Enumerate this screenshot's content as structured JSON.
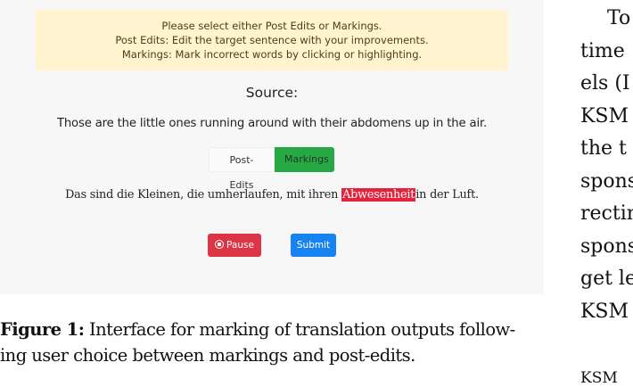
{
  "notice": {
    "line1": "Please select either Post Edits or Markings.",
    "line2": "Post Edits: Edit the target sentence with your improvements.",
    "line3": "Markings: Mark incorrect words by clicking or highlighting."
  },
  "source": {
    "label": "Source:",
    "text": "Those are the little ones running around with their abdomens up in the air."
  },
  "toggle": {
    "post_edits_label": "Post-Edits",
    "markings_label": "Markings",
    "active": "Markings"
  },
  "target": {
    "before": "Das sind die Kleinen, die umherlaufen, mit ihren ",
    "marked": "Abwesenheit",
    "after": "in der Luft."
  },
  "buttons": {
    "pause_label": "Pause",
    "submit_label": "Submit"
  },
  "colors": {
    "notice_bg": "#fff4cf",
    "markings_active": "#28a745",
    "marked_word": "#e4243f",
    "pause": "#dc3545",
    "submit": "#1683f0"
  },
  "caption": {
    "label": "Figure 1:",
    "line1_rest": "Interface for marking of translation outputs follow-",
    "line2": "ing user choice between markings and post-edits."
  },
  "right_column": {
    "lines": [
      "To",
      "time",
      "els (I",
      "KSM",
      "the t",
      "spons",
      "rectin",
      "spons",
      "get le",
      "KSM"
    ],
    "footer": "KSM"
  }
}
